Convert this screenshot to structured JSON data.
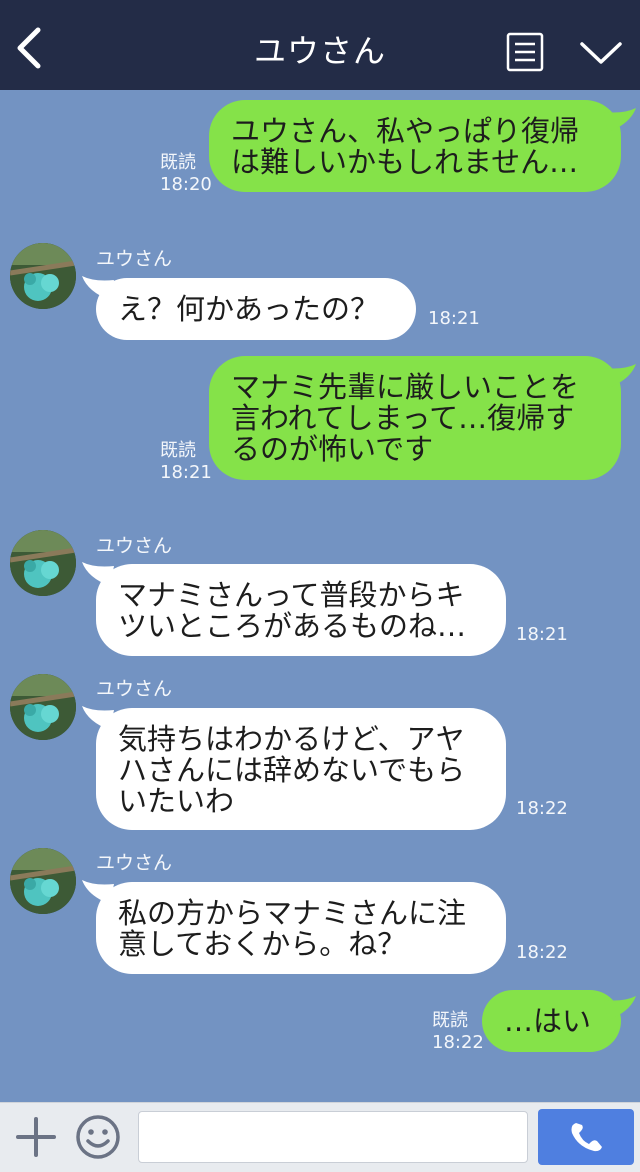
{
  "header": {
    "title": "ユウさん",
    "icons": [
      "back-chevron-icon",
      "menu-icon",
      "chevron-down-icon"
    ]
  },
  "colors": {
    "header_bg": "#232c47",
    "chat_bg": "#7393c2",
    "outgoing_bubble": "#85e249",
    "incoming_bubble": "#ffffff",
    "call_button": "#4f7fe0"
  },
  "messages": [
    {
      "direction": "out",
      "lines": [
        "ユウさん、私やっぱり復帰",
        "は難しいかもしれません…"
      ],
      "read": "既読",
      "time": "18:20"
    },
    {
      "direction": "in",
      "sender": "ユウさん",
      "lines": [
        "え？何かあったの？"
      ],
      "time": "18:21"
    },
    {
      "direction": "out",
      "lines": [
        "マナミ先輩に厳しいことを",
        "言われてしまって…復帰す",
        "るのが怖いです"
      ],
      "read": "既読",
      "time": "18:21"
    },
    {
      "direction": "in",
      "sender": "ユウさん",
      "lines": [
        "マナミさんって普段からキ",
        "ツいところがあるものね…"
      ],
      "time": "18:21"
    },
    {
      "direction": "in",
      "sender": "ユウさん",
      "lines": [
        "気持ちはわかるけど、アヤ",
        "ハさんには辞めないでもら",
        "いたいわ"
      ],
      "time": "18:22"
    },
    {
      "direction": "in",
      "sender": "ユウさん",
      "lines": [
        "私の方からマナミさんに注",
        "意しておくから。ね？"
      ],
      "time": "18:22"
    },
    {
      "direction": "out",
      "lines": [
        "…はい"
      ],
      "read": "既読",
      "time": "18:22"
    }
  ],
  "input": {
    "value": "",
    "icons": [
      "plus-icon",
      "smiley-icon",
      "phone-icon"
    ]
  }
}
